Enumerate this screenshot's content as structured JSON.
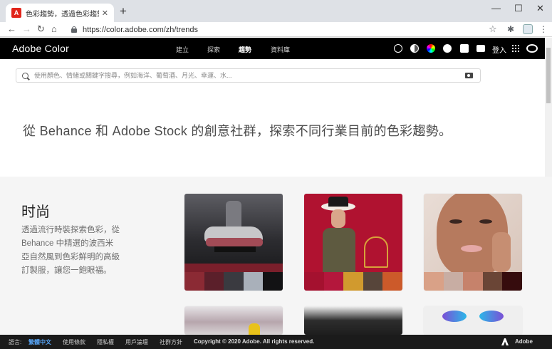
{
  "browser": {
    "tab_title": "色彩趨勢，透過色彩趨勢啟發創意",
    "tab_favicon": "A",
    "new_tab": "+",
    "close": "✕",
    "url": "https://color.adobe.com/zh/trends",
    "minimize": "—",
    "maximize": "☐"
  },
  "app": {
    "brand": "Adobe Color",
    "nav": [
      "建立",
      "探索",
      "趨勢",
      "資料庫"
    ],
    "active_nav": "趨勢",
    "login": "登入"
  },
  "search": {
    "placeholder": "使用顏色、情緒或關鍵字搜尋，例如海洋、葡萄酒、月光、幸運、水..."
  },
  "hero": {
    "text": "從 Behance 和 Adobe Stock 的創意社群，探索不同行業目前的色彩趨勢。"
  },
  "section": {
    "title": "时尚",
    "description": "透過流行時裝探索色彩，從 Behance 中精選的波西米亞自然風到色彩鮮明的高級訂製服，讓您一飽眼福。",
    "cards": [
      {
        "palette": [
          "#8b2a34",
          "#5b1f2a",
          "#3a3a40",
          "#a9b0ba",
          "#121214"
        ]
      },
      {
        "palette": [
          "#a4112f",
          "#b4173c",
          "#d19a2e",
          "#57453a",
          "#cc5a2a"
        ]
      },
      {
        "palette": [
          "#d9a187",
          "#c8ada3",
          "#c6826b",
          "#6a4536",
          "#360c0d"
        ]
      }
    ]
  },
  "footer": {
    "language_label": "語言:",
    "language_value": "繁體中文",
    "links": [
      "使用條款",
      "隱私權",
      "用戶論壇",
      "社群方針"
    ],
    "copyright": "Copyright © 2020 Adobe. All rights reserved.",
    "adobe": "Adobe"
  }
}
